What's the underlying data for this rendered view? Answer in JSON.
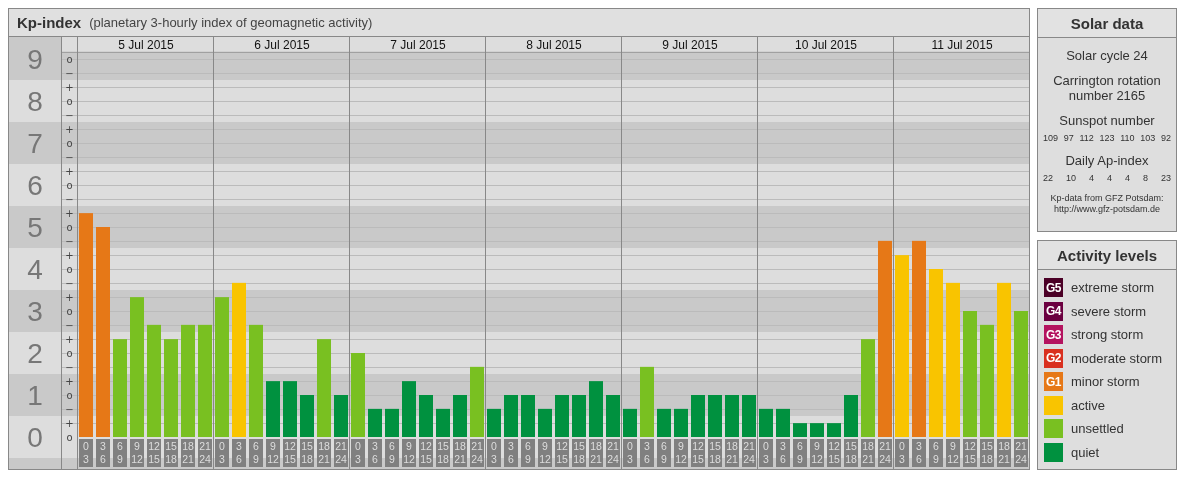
{
  "kp_panel": {
    "title": "Kp-index",
    "subtitle": "(planetary 3-hourly index of geomagnetic activity)",
    "days": [
      "5 Jul 2015",
      "6 Jul 2015",
      "7 Jul 2015",
      "8 Jul 2015",
      "9 Jul 2015",
      "10 Jul 2015",
      "11 Jul 2015"
    ],
    "kp_marks": [
      "o",
      "−",
      "+",
      "o",
      "−",
      "+",
      "o",
      "−",
      "+",
      "o",
      "−",
      "+",
      "o",
      "−",
      "+",
      "o",
      "−",
      "+",
      "o",
      "−",
      "+",
      "o",
      "−",
      "+",
      "o",
      "−",
      "+",
      "o"
    ],
    "chart_data": {
      "type": "bar",
      "grid": true,
      "ylim": [
        0,
        9.17
      ],
      "categories": [
        "0 3",
        "3 6",
        "6 9",
        "9 12",
        "12 15",
        "15 18",
        "18 21",
        "21 24",
        "0 3",
        "3 6",
        "6 9",
        "9 12",
        "12 15",
        "15 18",
        "18 21",
        "21 24",
        "0 3",
        "3 6",
        "6 9",
        "9 12",
        "12 15",
        "15 18",
        "18 21",
        "21 24",
        "0 3",
        "3 6",
        "6 9",
        "9 12",
        "12 15",
        "15 18",
        "18 21",
        "21 24",
        "0 3",
        "3 6",
        "6 9",
        "9 12",
        "12 15",
        "15 18",
        "18 21",
        "21 24",
        "0 3",
        "3 6",
        "6 9",
        "9 12",
        "12 15",
        "15 18",
        "18 21",
        "21 24",
        "0 3",
        "3 6",
        "6 9",
        "9 12",
        "12 15",
        "15 18",
        "18 21",
        "21 24"
      ],
      "yticks": [
        {
          "value": 0,
          "label": "0"
        },
        {
          "value": 1,
          "label": "1"
        },
        {
          "value": 2,
          "label": "2"
        },
        {
          "value": 3,
          "label": "3"
        },
        {
          "value": 4,
          "label": "4"
        },
        {
          "value": 5,
          "label": "5"
        },
        {
          "value": 6,
          "label": "6"
        },
        {
          "value": 7,
          "label": "7"
        },
        {
          "value": 8,
          "label": "8"
        },
        {
          "value": 9,
          "label": "9"
        }
      ],
      "series": [
        {
          "color": "#00913f",
          "values": [
            null,
            null,
            null,
            null,
            null,
            null,
            null,
            null,
            null,
            null,
            null,
            1.33,
            1.33,
            1,
            null,
            1,
            null,
            0.67,
            0.67,
            1.33,
            1,
            0.67,
            1,
            null,
            0.67,
            1,
            1,
            0.67,
            1,
            1,
            1.33,
            1,
            0.67,
            null,
            0.67,
            0.67,
            1,
            1,
            1,
            1,
            0.67,
            0.67,
            0.33,
            0.33,
            0.33,
            1,
            null,
            null,
            null,
            null,
            null,
            null,
            null,
            null,
            null,
            null
          ]
        },
        {
          "color": "#79c021",
          "values": [
            null,
            null,
            2.33,
            3.33,
            2.67,
            2.33,
            2.67,
            2.67,
            3.33,
            null,
            2.67,
            null,
            null,
            null,
            2.33,
            null,
            2,
            null,
            null,
            null,
            null,
            null,
            null,
            1.67,
            null,
            null,
            null,
            null,
            null,
            null,
            null,
            null,
            null,
            1.67,
            null,
            null,
            null,
            null,
            null,
            null,
            null,
            null,
            null,
            null,
            null,
            null,
            2.33,
            null,
            null,
            null,
            null,
            null,
            3,
            2.67,
            null,
            3
          ]
        },
        {
          "color": "#f9c400",
          "values": [
            null,
            null,
            null,
            null,
            null,
            null,
            null,
            null,
            null,
            3.67,
            null,
            null,
            null,
            null,
            null,
            null,
            null,
            null,
            null,
            null,
            null,
            null,
            null,
            null,
            null,
            null,
            null,
            null,
            null,
            null,
            null,
            null,
            null,
            null,
            null,
            null,
            null,
            null,
            null,
            null,
            null,
            null,
            null,
            null,
            null,
            null,
            null,
            null,
            4.33,
            null,
            4,
            3.67,
            null,
            null,
            3.67,
            null
          ]
        },
        {
          "color": "#e67817",
          "values": [
            5.33,
            5,
            null,
            null,
            null,
            null,
            null,
            null,
            null,
            null,
            null,
            null,
            null,
            null,
            null,
            null,
            null,
            null,
            null,
            null,
            null,
            null,
            null,
            null,
            null,
            null,
            null,
            null,
            null,
            null,
            null,
            null,
            null,
            null,
            null,
            null,
            null,
            null,
            null,
            null,
            null,
            null,
            null,
            null,
            null,
            null,
            null,
            4.67,
            null,
            4.67,
            null,
            null,
            null,
            null,
            null,
            null
          ]
        }
      ]
    }
  },
  "solar_panel": {
    "title": "Solar data",
    "cycle": "Solar cycle 24",
    "rotation": "Carrington rotation number 2165",
    "sunspot_heading": "Sunspot number",
    "sunspot_numbers": [
      "109",
      "97",
      "112",
      "123",
      "110",
      "103",
      "92"
    ],
    "ap_heading": "Daily Ap-index",
    "ap_values": [
      "22",
      "10",
      "4",
      "4",
      "4",
      "8",
      "23"
    ],
    "source": "Kp-data from GFZ Potsdam:",
    "source_url": "http://www.gfz-potsdam.de"
  },
  "activity_panel": {
    "title": "Activity levels",
    "items": [
      {
        "badge": "G5",
        "label": "extreme storm",
        "color": "#4b0026"
      },
      {
        "badge": "G4",
        "label": "severe storm",
        "color": "#6b0040"
      },
      {
        "badge": "G3",
        "label": "strong storm",
        "color": "#b4135f"
      },
      {
        "badge": "G2",
        "label": "moderate storm",
        "color": "#d9301f"
      },
      {
        "badge": "G1",
        "label": "minor storm",
        "color": "#e67817"
      },
      {
        "label": "active",
        "color": "#f9c400"
      },
      {
        "label": "unsettled",
        "color": "#79c021"
      },
      {
        "label": "quiet",
        "color": "#00913f"
      }
    ]
  }
}
